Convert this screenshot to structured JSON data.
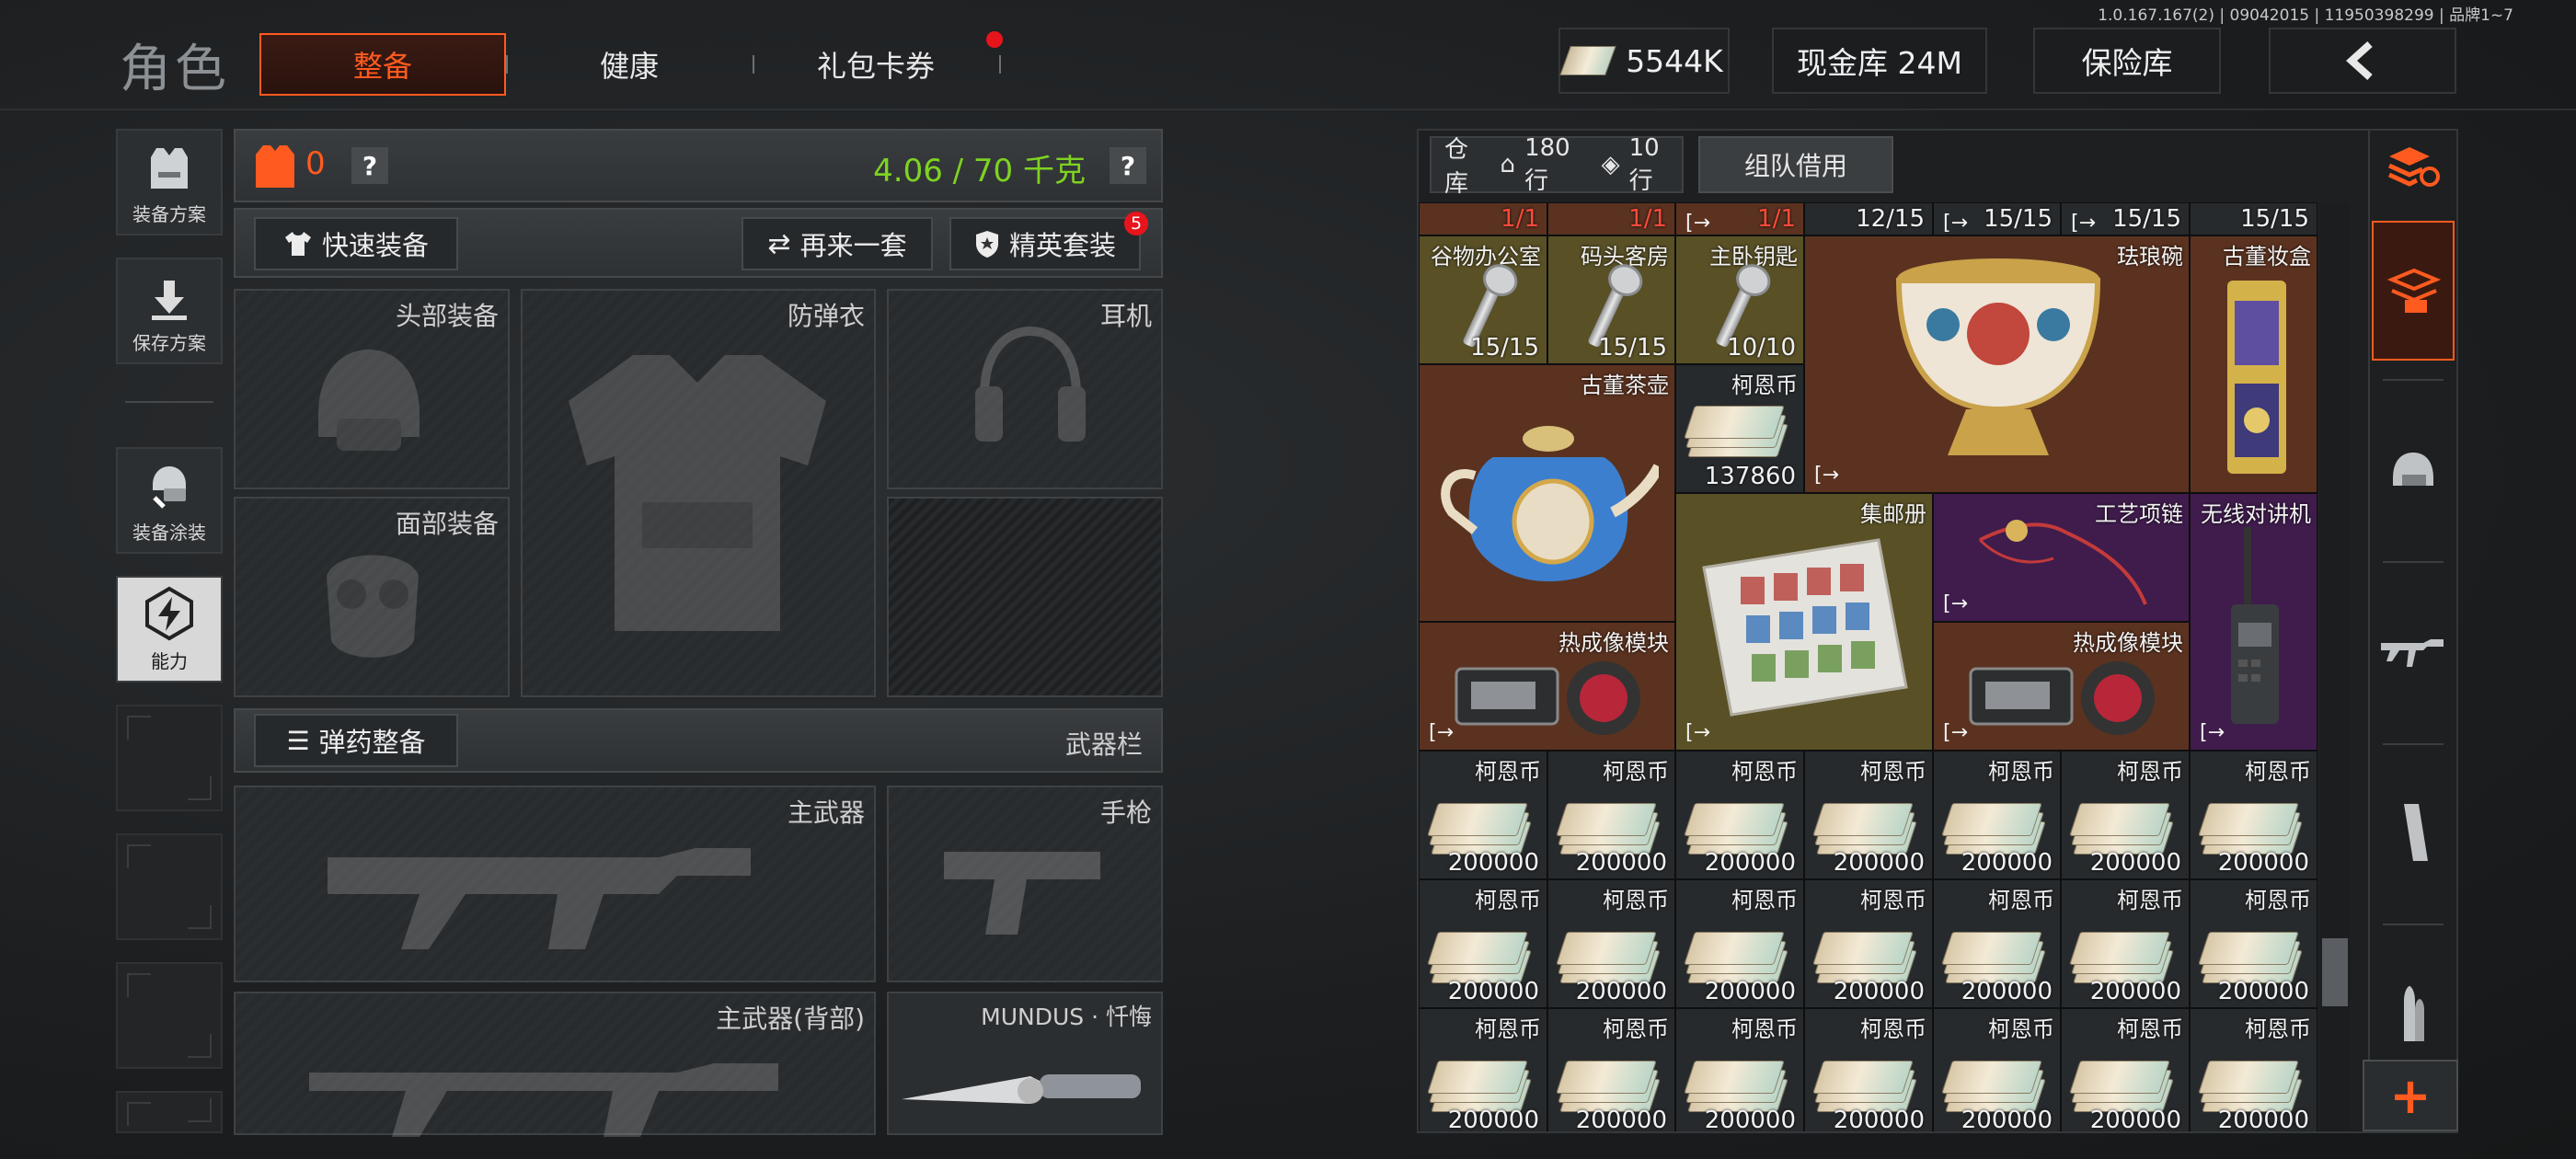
{
  "header": {
    "page_title": "角色",
    "tabs": [
      {
        "label": "整备",
        "active": true
      },
      {
        "label": "健康",
        "active": false
      },
      {
        "label": "礼包卡券",
        "active": false
      }
    ],
    "version": "1.0.167.167(2) | 09042015 | 11950398299 | 品牌1~7",
    "currency_amount": "5544K",
    "cash_vault_label": "现金库 24M",
    "insurance_label": "保险库",
    "back_icon": "chevron-left-icon"
  },
  "sidebar": {
    "items": [
      {
        "label": "装备方案",
        "icon": "vest-icon"
      },
      {
        "label": "保存方案",
        "icon": "download-icon"
      },
      {
        "label": "装备涂装",
        "icon": "paint-icon"
      },
      {
        "label": "能力",
        "icon": "lightning-icon"
      }
    ]
  },
  "loadout": {
    "armor_count": "0",
    "weight": "4.06 / 70 千克",
    "help": "?",
    "quick_equip": "快速装备",
    "another_set": "再来一套",
    "elite_set": "精英套装",
    "elite_badge": "5",
    "slots": {
      "head": "头部装备",
      "body_armor": "防弹衣",
      "earphone": "耳机",
      "face": "面部装备"
    },
    "ammo_equip": "弹药整备",
    "weapon_bar": "武器栏",
    "weapons": {
      "primary": "主武器",
      "pistol": "手枪",
      "primary_back": "主武器(背部)",
      "melee": "MUNDUS · 忏悔"
    }
  },
  "stash": {
    "warehouse_label": "仓库",
    "rows": "180行",
    "extra_rows": "10行",
    "team_borrow": "组队借用",
    "top_counts": [
      "1/1",
      "1/1",
      "1/1",
      "12/15",
      "15/15",
      "15/15",
      "15/15"
    ],
    "keys": [
      {
        "name": "谷物办公室",
        "count": "15/15"
      },
      {
        "name": "码头客房",
        "count": "15/15"
      },
      {
        "name": "主卧钥匙",
        "count": "10/10"
      }
    ],
    "large_items": {
      "enamel_bowl": "珐琅碗",
      "antique_box": "古董妆盒",
      "antique_teapot": "古董茶壶",
      "coin_small": {
        "name": "柯恩币",
        "count": "137860"
      },
      "stamp_album": "集邮册",
      "necklace": "工艺项链",
      "radio": "无线对讲机",
      "thermal_1": "热成像模块",
      "thermal_2": "热成像模块"
    },
    "coin_name": "柯恩币",
    "coin_count": "200000"
  },
  "right_column": {
    "icons": [
      "stack-refresh-icon",
      "stash-active-icon",
      "helmet-icon",
      "rifle-icon",
      "magazine-icon",
      "ammo-icon"
    ],
    "add": "+"
  },
  "colors": {
    "accent": "#ff5a1f",
    "weight_green": "#7ed321",
    "badge_red": "#e8141c"
  }
}
